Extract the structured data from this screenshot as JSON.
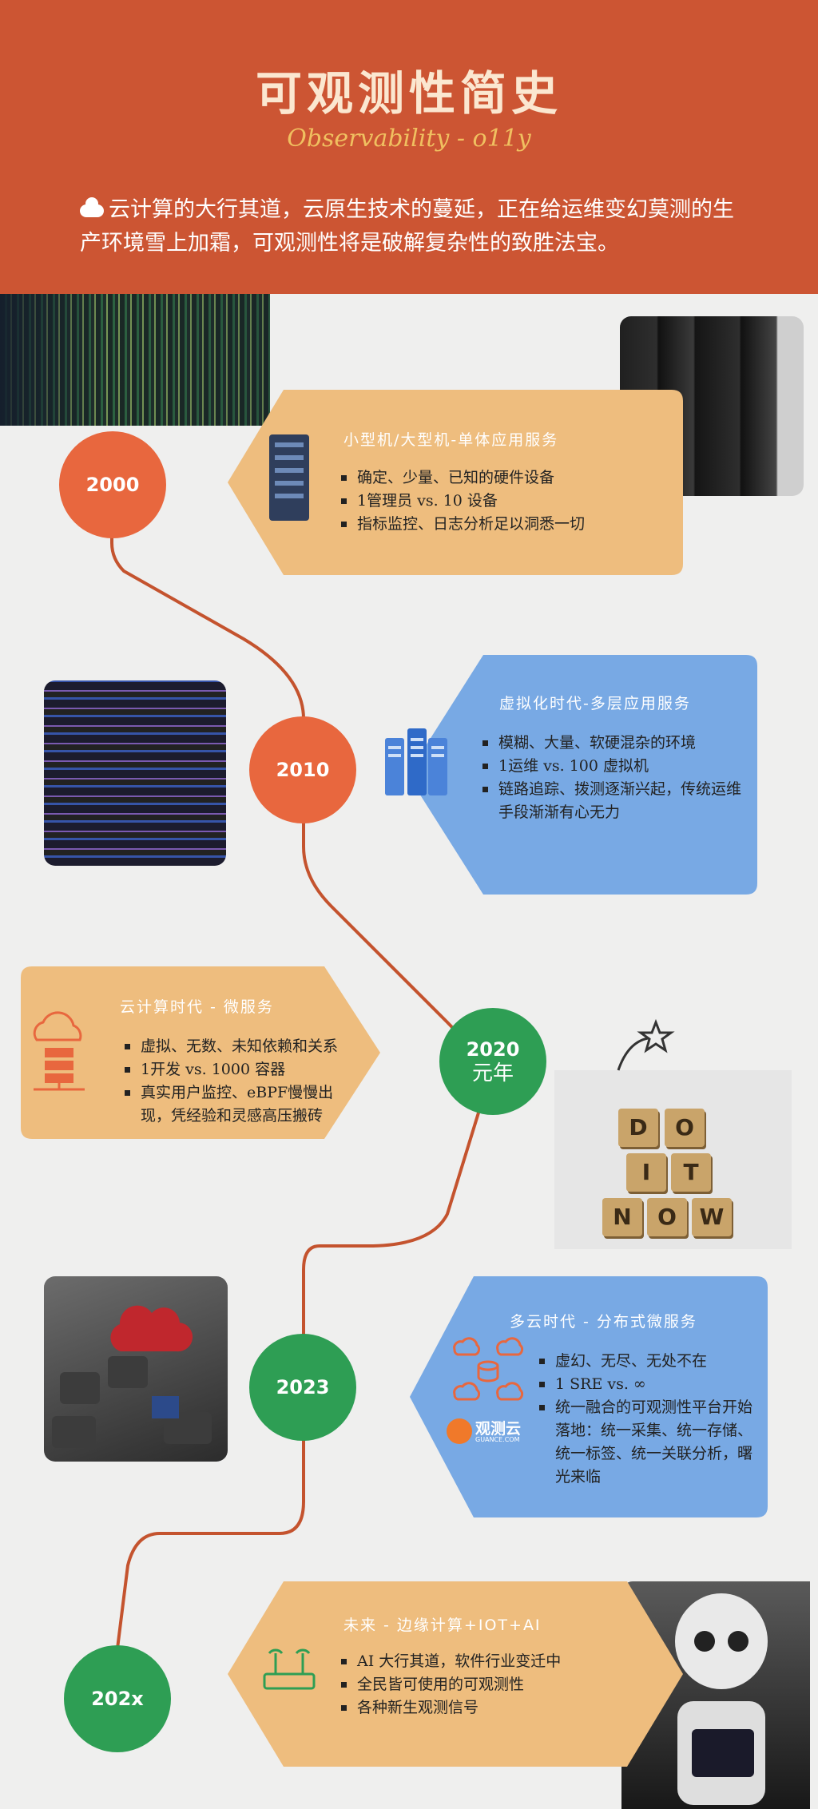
{
  "header": {
    "title": "可观测性简史",
    "subtitle": "Observability - o11y",
    "intro": "云计算的大行其道，云原生技术的蔓延，正在给运维变幻莫测的生产环境雪上加霜，可观测性将是破解复杂性的致胜法宝。"
  },
  "eras": [
    {
      "year": "2000",
      "title": "小型机/大型机-单体应用服务",
      "bullets": [
        "确定、少量、已知的硬件设备",
        "1管理员 vs. 10 设备",
        "指标监控、日志分析足以洞悉一切"
      ]
    },
    {
      "year": "2010",
      "title": "虚拟化时代-多层应用服务",
      "bullets": [
        "模糊、大量、软硬混杂的环境",
        "1运维 vs. 100 虚拟机",
        "链路追踪、拨测逐渐兴起，传统运维手段渐渐有心无力"
      ]
    },
    {
      "year": "2020",
      "year_sub": "元年",
      "title": "云计算时代 - 微服务",
      "bullets": [
        "虚拟、无数、未知依赖和关系",
        "1开发 vs. 1000 容器",
        "真实用户监控、eBPF慢慢出现，凭经验和灵感高压搬砖"
      ]
    },
    {
      "year": "2023",
      "title": "多云时代 - 分布式微服务",
      "bullets": [
        "虚幻、无尽、无处不在",
        "1 SRE vs. ∞",
        "统一融合的可观测性平台开始落地：统一采集、统一存储、统一标签、统一关联分析，曙光来临"
      ],
      "brand": "观测云",
      "brand_sub": "GUANCE.COM"
    },
    {
      "year": "202x",
      "title": "未来 - 边缘计算+IOT+AI",
      "bullets": [
        "AI 大行其道，软件行业变迁中",
        "全民皆可使用的可观测性",
        "各种新生观测信号"
      ]
    }
  ],
  "scrabble": {
    "row1": [
      "D",
      "O"
    ],
    "row2": [
      "I",
      "T"
    ],
    "row3": [
      "N",
      "O",
      "W"
    ]
  },
  "colors": {
    "header": "#cc5533",
    "peach": "#eebd7e",
    "blue": "#78a9e4",
    "orange": "#e8673e",
    "green": "#2e9e54",
    "line": "#c4532e"
  }
}
